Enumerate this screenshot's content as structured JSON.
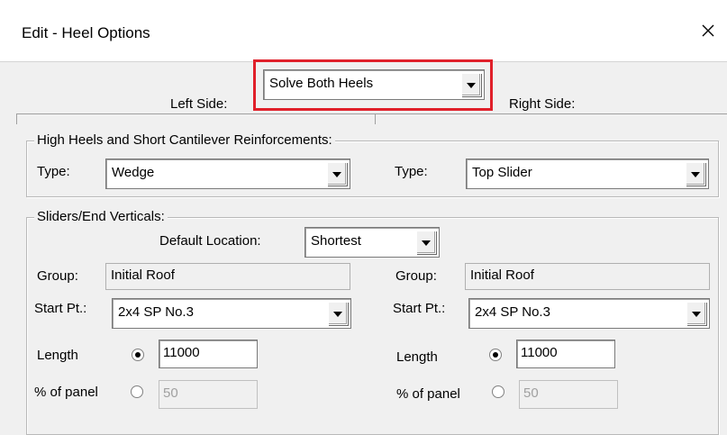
{
  "dialog": {
    "title": "Edit - Heel Options",
    "close_icon": "close-icon"
  },
  "heel_mode": {
    "label_left": "Left Side:",
    "label_right": "Right Side:",
    "selected": "Solve Both Heels"
  },
  "reinforcements": {
    "legend": "High Heels and  Short Cantilever Reinforcements:",
    "left_type_label": "Type:",
    "left_type_value": "Wedge",
    "right_type_label": "Type:",
    "right_type_value": "Top Slider"
  },
  "sliders": {
    "legend": "Sliders/End Verticals:",
    "default_location_label": "Default Location:",
    "default_location_value": "Shortest",
    "left": {
      "group_label": "Group:",
      "group_value": "Initial Roof",
      "start_label": "Start Pt.:",
      "start_value": "2x4 SP No.3",
      "length_label": "Length",
      "length_value": "11000",
      "length_selected": true,
      "percent_label": "% of panel",
      "percent_value": "50",
      "percent_selected": false
    },
    "right": {
      "group_label": "Group:",
      "group_value": "Initial Roof",
      "start_label": "Start Pt.:",
      "start_value": "2x4 SP No.3",
      "length_label": "Length",
      "length_value": "11000",
      "length_selected": true,
      "percent_label": "% of panel",
      "percent_value": "50",
      "percent_selected": false
    }
  },
  "colors": {
    "highlight": "#e0202a",
    "background": "#f0f0f0"
  }
}
